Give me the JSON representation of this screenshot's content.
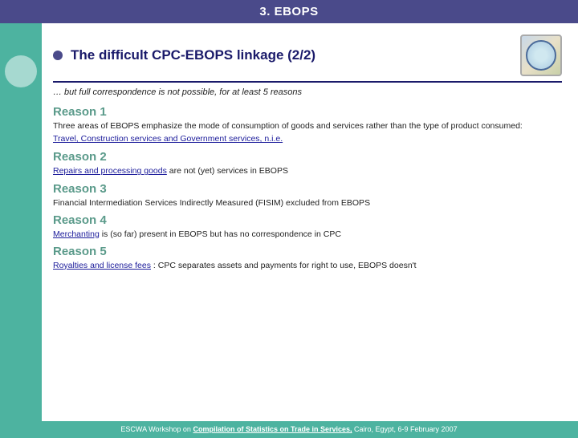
{
  "header": {
    "title": "3. EBOPS"
  },
  "slide": {
    "bullet": "○",
    "title": "The difficult CPC-EBOPS linkage (2/2)",
    "divider": true,
    "intro": "… but full correspondence is not possible, for at least 5 reasons",
    "reasons": [
      {
        "id": "reason1",
        "title": "Reason 1",
        "body": "Three areas of EBOPS emphasize the mode of consumption of goods and services rather than the type of product consumed:",
        "links": "Travel, Construction services and Government services, n.i.e."
      },
      {
        "id": "reason2",
        "title": "Reason 2",
        "body": "are not (yet) services in EBOPS",
        "links": "Repairs and processing goods"
      },
      {
        "id": "reason3",
        "title": "Reason 3",
        "body": "Financial Intermediation Services Indirectly Measured (FISIM) excluded from EBOPS",
        "links": ""
      },
      {
        "id": "reason4",
        "title": "Reason 4",
        "body": "is (so far) present in EBOPS but has no correspondence in CPC",
        "links": "Merchanting"
      },
      {
        "id": "reason5",
        "title": "Reason 5",
        "body": ": CPC separates assets and payments for right to use, EBOPS doesn't",
        "links": "Royalties and license fees"
      }
    ]
  },
  "footer": {
    "prefix": "ESCWA Workshop on ",
    "highlight": "Compilation of Statistics on Trade in Services,",
    "suffix": " Cairo, Egypt, 6-9 February 2007"
  }
}
